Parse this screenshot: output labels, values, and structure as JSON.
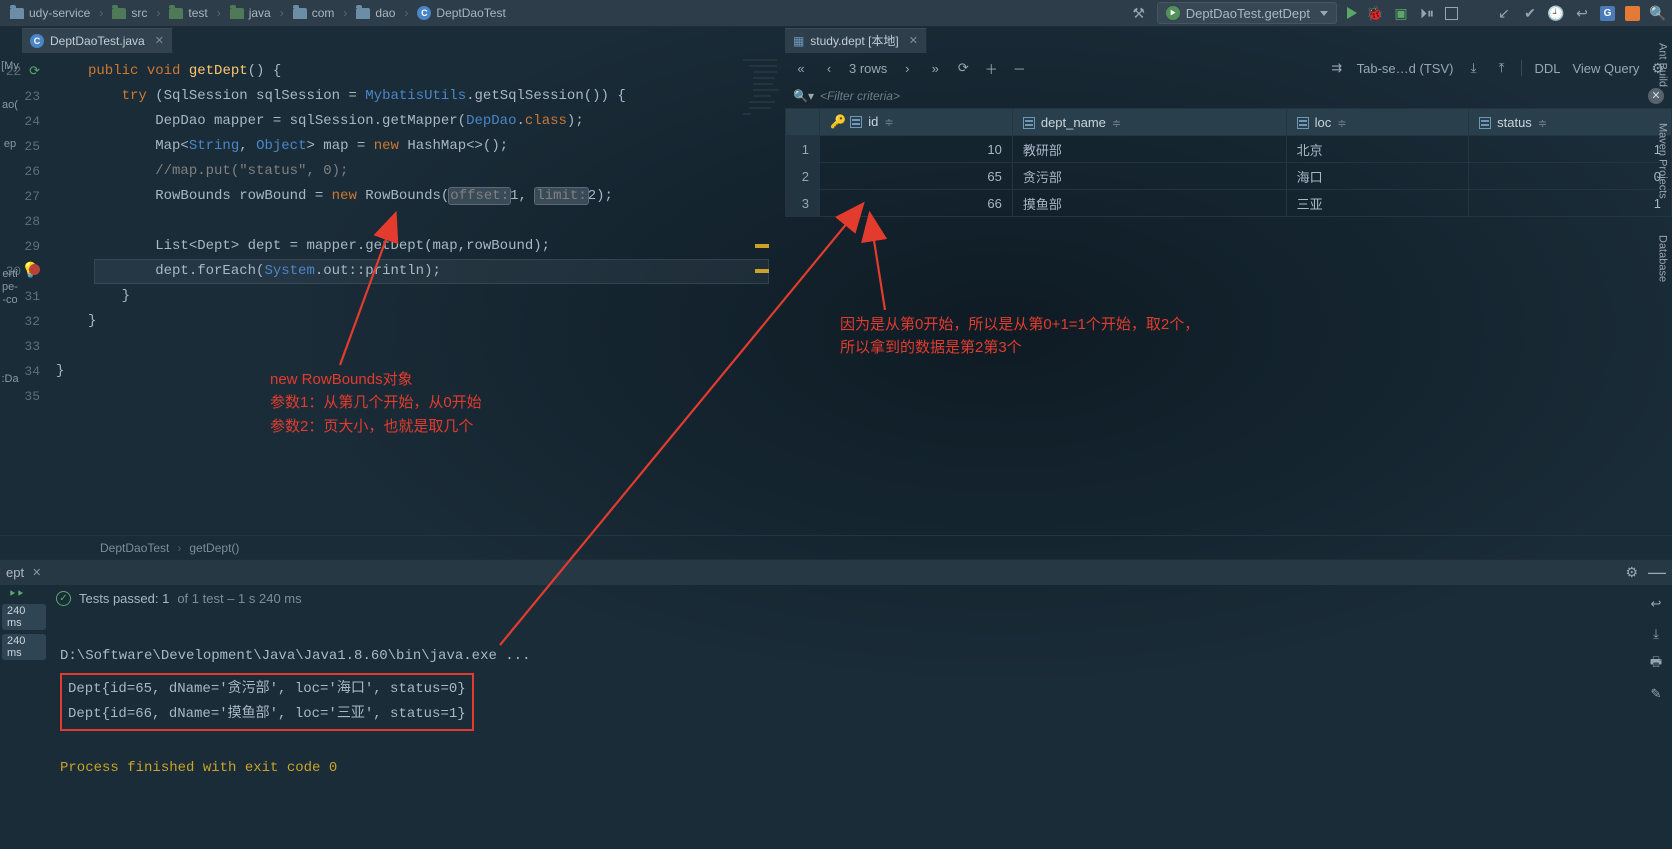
{
  "breadcrumb": {
    "items": [
      "udy-service",
      "src",
      "test",
      "java",
      "com",
      "dao",
      "DeptDaoTest"
    ]
  },
  "run_config": {
    "label": "DeptDaoTest.getDept"
  },
  "editor_tabs": {
    "code": {
      "label": "DeptDaoTest.java"
    },
    "db": {
      "label": "study.dept [本地]"
    }
  },
  "gutter": {
    "start": 22,
    "end": 35
  },
  "code": {
    "l1": "public",
    "l1b": "void",
    "l1c": "getDept",
    "l1d": "() {",
    "l2": "try",
    "l2b": "(SqlSession sqlSession = ",
    "l2c": "MybatisUtils",
    "l2d": ".getSqlSession()) {",
    "l3a": "DepDao mapper = sqlSession.getMapper(",
    "l3b": "DepDao",
    "l3c": ".",
    "l3d": "class",
    "l3e": ");",
    "l4a": "Map<",
    "l4b": "String",
    "l4c": ", ",
    "l4d": "Object",
    "l4e": "> map = ",
    "l4f": "new",
    "l4g": " HashMap<>();",
    "l5": "//map.put(\"status\", 0);",
    "l6a": "RowBounds rowBound = ",
    "l6b": "new",
    "l6c": " RowBounds(",
    "l6d": "offset:",
    "l6e": "1, ",
    "l6f": "limit:",
    "l6g": "2);",
    "l7": "",
    "l8": "List<Dept> dept = mapper.getDept(map,rowBound);",
    "l9a": "dept.forEach(",
    "l9b": "System",
    "l9c": ".out::println);",
    "l10": "}",
    "l11": "}",
    "l12": "",
    "l13": "}"
  },
  "editor_bc": {
    "a": "DeptDaoTest",
    "b": "getDept()"
  },
  "db": {
    "rows_label": "3 rows",
    "format": "Tab-se…d (TSV)",
    "ddl": "DDL",
    "view_query": "View Query",
    "filter_placeholder": "<Filter criteria>",
    "columns": [
      "id",
      "dept_name",
      "loc",
      "status"
    ],
    "data": [
      {
        "n": 1,
        "id": 10,
        "dept_name": "教研部",
        "loc": "北京",
        "status": 1
      },
      {
        "n": 2,
        "id": 65,
        "dept_name": "贪污部",
        "loc": "海口",
        "status": 0
      },
      {
        "n": 3,
        "id": 66,
        "dept_name": "摸鱼部",
        "loc": "三亚",
        "status": 1
      }
    ]
  },
  "run": {
    "tab": "ept",
    "chip1": "240 ms",
    "chip2": "240 ms",
    "tests_a": "Tests passed: 1",
    "tests_b": " of 1 test – 1 s 240 ms",
    "line1": "D:\\Software\\Development\\Java\\Java1.8.60\\bin\\java.exe ...",
    "line2": "Dept{id=65, dName='贪污部', loc='海口', status=0}",
    "line3": "Dept{id=66, dName='摸鱼部', loc='三亚', status=1}",
    "done": "Process finished with exit code 0"
  },
  "right_tools": {
    "ant": "Ant Build",
    "maven": "Maven Projects",
    "database": "Database"
  },
  "anno": {
    "a": "new RowBounds对象\n参数1：从第几个开始，从0开始\n参数2：页大小，也就是取几个",
    "b": "因为是从第0开始，所以是从第0+1=1个开始，取2个，\n所以拿到的数据是第2第3个"
  }
}
